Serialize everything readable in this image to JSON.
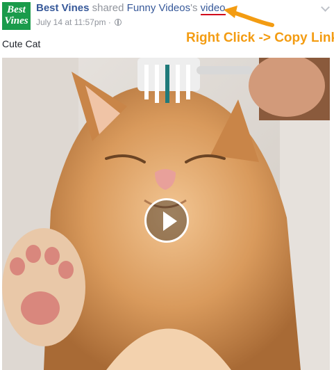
{
  "post": {
    "page_name": "Best Vines",
    "avatar_line1": "Best",
    "avatar_line2": "Vines",
    "action_text": "shared",
    "shared_from": "Funny Videos",
    "possessive": "'s",
    "object_link": "video",
    "timestamp": "July 14 at 11:57pm",
    "separator": "·",
    "caption": "Cute Cat"
  },
  "annotation": {
    "text": "Right Click -> Copy Link",
    "color": "#f39c12"
  },
  "video": {
    "subject": "orange kitten being brushed with a toothbrush"
  },
  "icons": {
    "privacy": "globe-icon",
    "menu": "chevron-down-icon",
    "play": "play-icon"
  },
  "colors": {
    "link": "#365899",
    "meta": "#90949c",
    "underline": "#d0021b",
    "avatar_bg": "#1a9b4b"
  }
}
